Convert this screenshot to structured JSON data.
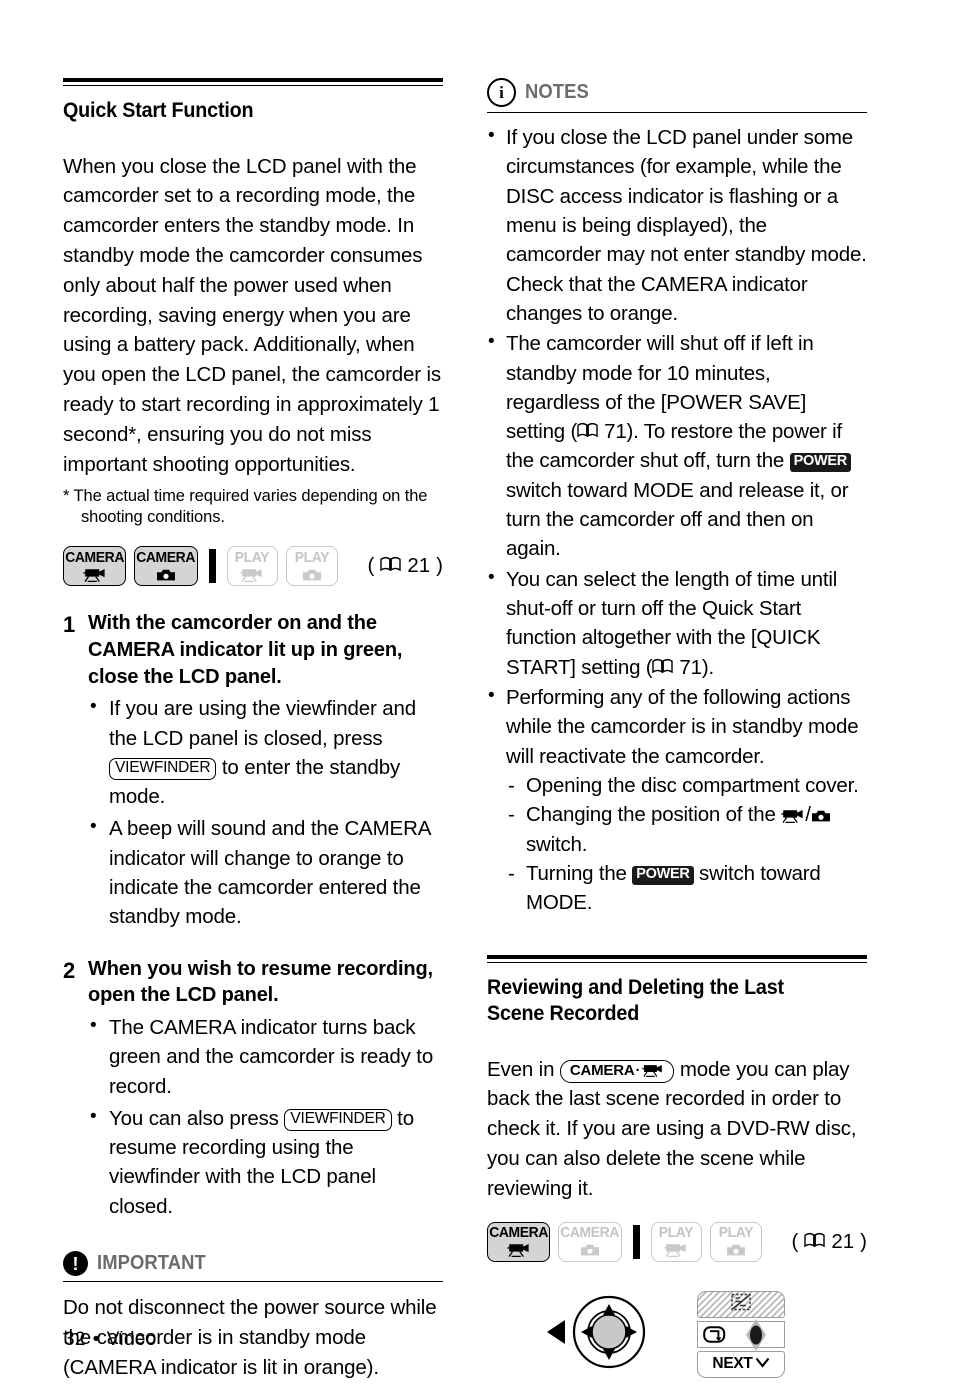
{
  "left_column": {
    "section": {
      "title": "Quick Start Function",
      "paragraph": "When you close the LCD panel with the camcorder set to a recording mode, the camcorder enters the standby mode. In standby mode the camcorder consumes only about half the power used when recording, saving energy when you are using a battery pack. Additionally, when you open the LCD panel, the camcorder is ready to start recording in approximately 1 second*, ensuring you do not miss important shooting opportunities.",
      "footnote": "*  The actual time required varies depending on the shooting conditions."
    },
    "mode_bar": {
      "chips": [
        {
          "label": "CAMERA",
          "glyph": "video-camera-icon",
          "active": true
        },
        {
          "label": "CAMERA",
          "glyph": "still-camera-icon",
          "active": true
        },
        {
          "label": "PLAY",
          "glyph": "video-camera-icon",
          "active": false
        },
        {
          "label": "PLAY",
          "glyph": "still-camera-icon",
          "active": false
        }
      ],
      "page_ref": "21",
      "page_ref_open": "(",
      "page_ref_close": ")"
    },
    "steps": [
      {
        "number": "1",
        "text": "With the camcorder on and the CAMERA indicator lit up in green, close the LCD panel.",
        "bullets": [
          {
            "pre": "If you are using the viewfinder and the LCD panel is closed, press ",
            "button": "VIEWFINDER",
            "post": " to enter the standby mode."
          },
          {
            "pre": "A beep will sound and the CAMERA indicator will change to orange to indicate the camcorder entered the standby mode.",
            "button": "",
            "post": ""
          }
        ]
      },
      {
        "number": "2",
        "text": "When you wish to resume recording, open the LCD panel.",
        "bullets": [
          {
            "pre": "The CAMERA indicator turns back green and the camcorder is ready to record.",
            "button": "",
            "post": ""
          },
          {
            "pre": "You can also press ",
            "button": "VIEWFINDER",
            "post": " to resume recording using the viewfinder with the LCD panel closed."
          }
        ]
      }
    ],
    "important": {
      "icon": "exclamation-icon",
      "title": "IMPORTANT",
      "body": "Do not disconnect the power source while the camcorder is in standby mode (CAMERA indicator is lit in orange)."
    }
  },
  "right_column": {
    "notes": {
      "icon": "info-icon",
      "title": "NOTES",
      "items": [
        {
          "segments": [
            {
              "type": "text",
              "value": "If you close the LCD panel under some circumstances (for example, while the DISC access indicator is flashing or a menu is being displayed), the camcorder may not enter standby mode. Check that the CAMERA indicator changes to orange."
            }
          ]
        },
        {
          "segments": [
            {
              "type": "text",
              "value": "The camcorder will shut off if left in standby mode for 10 minutes, regardless of the [POWER SAVE] setting ("
            },
            {
              "type": "book",
              "value": "71"
            },
            {
              "type": "text",
              "value": "). To restore the power if the camcorder shut off, turn the "
            },
            {
              "type": "inverse-button",
              "value": "POWER"
            },
            {
              "type": "text",
              "value": " switch toward MODE and release it, or turn the camcorder off and then on again."
            }
          ]
        },
        {
          "segments": [
            {
              "type": "text",
              "value": "You can select the length of time until shut-off or turn off the Quick Start function altogether with the [QUICK START] setting ("
            },
            {
              "type": "book",
              "value": "71"
            },
            {
              "type": "text",
              "value": ")."
            }
          ]
        },
        {
          "segments": [
            {
              "type": "text",
              "value": "Performing any of the following actions while the camcorder is in standby mode will reactivate the camcorder."
            }
          ],
          "sub_items": [
            {
              "segments": [
                {
                  "type": "text",
                  "value": "Opening the disc compartment cover."
                }
              ]
            },
            {
              "segments": [
                {
                  "type": "text",
                  "value": "Changing the position of the "
                },
                {
                  "type": "glyph-pair",
                  "value": "video-camera-icon/still-camera-icon"
                },
                {
                  "type": "text",
                  "value": " switch."
                }
              ]
            },
            {
              "segments": [
                {
                  "type": "text",
                  "value": "Turning the "
                },
                {
                  "type": "inverse-button",
                  "value": "POWER"
                },
                {
                  "type": "text",
                  "value": " switch toward MODE."
                }
              ]
            }
          ]
        }
      ]
    },
    "section": {
      "title": "Reviewing and Deleting the Last Scene Recorded",
      "paragraph_pre": "Even in ",
      "mode_pill": {
        "label": "CAMERA",
        "separator": "·",
        "glyph": "video-camera-icon"
      },
      "paragraph_post": " mode you can play back the last scene recorded in order to check it. If you are using a DVD-RW disc, you can also delete the scene while reviewing it."
    },
    "mode_bar": {
      "chips": [
        {
          "label": "CAMERA",
          "glyph": "video-camera-icon",
          "active": true
        },
        {
          "label": "CAMERA",
          "glyph": "still-camera-icon",
          "active": false
        },
        {
          "label": "PLAY",
          "glyph": "video-camera-icon",
          "active": false
        },
        {
          "label": "PLAY",
          "glyph": "still-camera-icon",
          "active": false
        }
      ],
      "page_ref": "21",
      "page_ref_open": "(",
      "page_ref_close": ")"
    },
    "joystick": {
      "control_name": "joystick-4way",
      "guide_rows": [
        {
          "name": "guide-row-disabled",
          "label": "",
          "icon": "no-entry-hatched-icon"
        },
        {
          "name": "guide-row-review",
          "label": "",
          "icon": "replay-loop-icon"
        },
        {
          "name": "guide-row-next",
          "label": "NEXT",
          "icon": "chevron-down-icon"
        }
      ]
    }
  },
  "footer": {
    "page_number": "32",
    "separator": "•",
    "section_name": "Video"
  }
}
